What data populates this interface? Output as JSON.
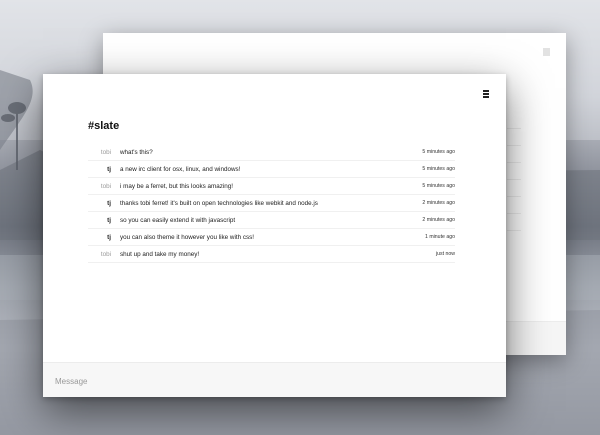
{
  "channel": {
    "name": "#slate"
  },
  "messages": [
    {
      "author": "tobi",
      "text": "what's this?",
      "time": "5 minutes ago"
    },
    {
      "author": "tj",
      "text": "a new irc client for osx, linux, and windows!",
      "time": "5 minutes ago"
    },
    {
      "author": "tobi",
      "text": "i may be a ferret, but this looks amazing!",
      "time": "5 minutes ago"
    },
    {
      "author": "tj",
      "text": "thanks tobi ferret! it's built on open technologies like webkit and node.js",
      "time": "2 minutes ago"
    },
    {
      "author": "tj",
      "text": "so you can easily extend it with javascript",
      "time": "2 minutes ago"
    },
    {
      "author": "tj",
      "text": "you can also theme it however you like with css!",
      "time": "1 minute ago"
    },
    {
      "author": "tobi",
      "text": "shut up and take my money!",
      "time": "just now"
    }
  ],
  "composer": {
    "placeholder": "Message",
    "value": ""
  },
  "icons": {
    "menu": "hamburger-menu-icon"
  }
}
